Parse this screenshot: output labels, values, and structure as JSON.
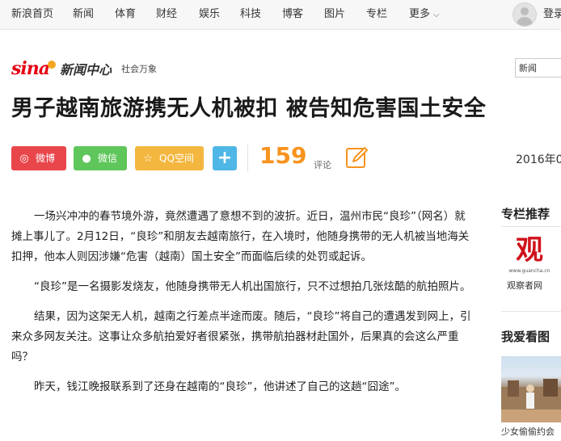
{
  "topnav": {
    "items": [
      "新浪首页",
      "新闻",
      "体育",
      "财经",
      "娱乐",
      "科技",
      "博客",
      "图片",
      "专栏",
      "更多"
    ],
    "user_text": "登录"
  },
  "header": {
    "logo_sina": "sina",
    "logo_cn": "新闻中心",
    "channel": "社会万象",
    "select_value": "新闻"
  },
  "article": {
    "title": "男子越南旅游携无人机被扣 被告知危害国土安全",
    "share": {
      "weibo": "微博",
      "wechat": "微信",
      "qzone": "QQ空间",
      "more": "+"
    },
    "comment_count": "159",
    "comment_label": "评论",
    "date": "2016年0",
    "paragraphs": [
      "一场兴冲冲的春节境外游，竟然遭遇了意想不到的波折。近日，温州市民“良珍”（网名）就摊上事儿了。2月12日，“良珍”和朋友去越南旅行，在入境时，他随身携带的无人机被当地海关扣押，他本人则因涉嫌“危害（越南）国土安全”而面临后续的处罚或起诉。",
      "“良珍”是一名摄影发烧友，他随身携带无人机出国旅行，只不过想拍几张炫酷的航拍照片。",
      "结果，因为这架无人机，越南之行差点半途而废。随后，“良珍”将自己的遭遇发到网上，引来众多网友关注。这事让众多航拍爱好者很紧张，携带航拍器材赴国外，后果真的会这么严重吗？",
      "昨天，钱江晚报联系到了还身在越南的“良珍”，他讲述了自己的这趟“囧途”。"
    ]
  },
  "sidebar": {
    "column_title": "专栏推荐",
    "column_logo_char": "观",
    "column_logo_url_text": "www.guancha.cn",
    "column_caption": "观察者网",
    "likes_title": "我爱看图",
    "photo_caption": "少女偷偷约会"
  },
  "colors": {
    "weibo": "#e9464c",
    "wechat": "#5ec65a",
    "qzone": "#f3b73f",
    "more": "#4eb7e6",
    "comment_accent": "#f7931e",
    "brand_red": "#e60012"
  }
}
